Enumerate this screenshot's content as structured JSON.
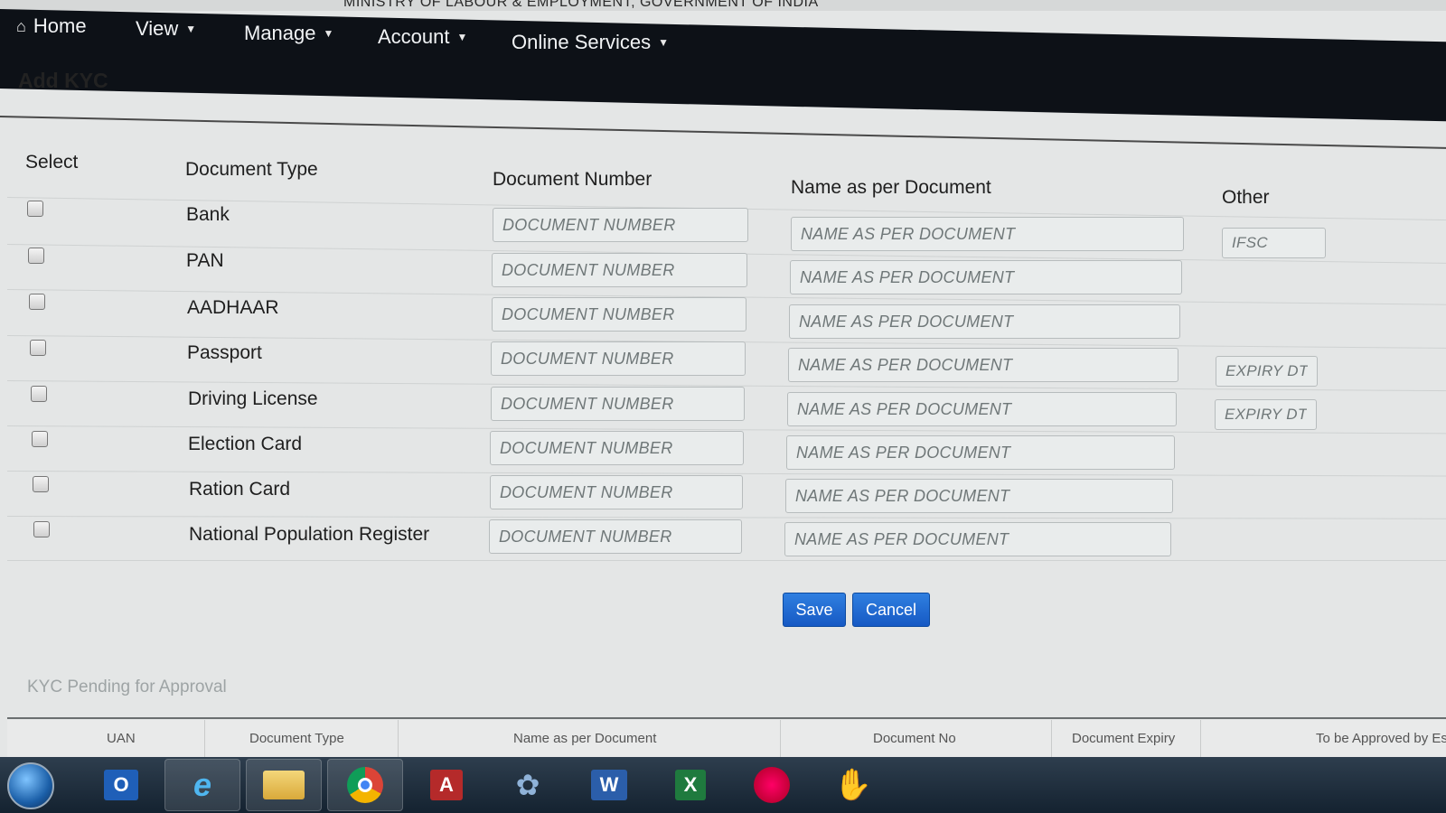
{
  "top_strip": "MINISTRY OF LABOUR & EMPLOYMENT, GOVERNMENT OF INDIA",
  "nav": {
    "home": "Home",
    "view": "View",
    "manage": "Manage",
    "account": "Account",
    "online_services": "Online Services"
  },
  "page_title": "Add KYC",
  "columns": {
    "select": "Select",
    "document_type": "Document Type",
    "document_number": "Document Number",
    "name_as_per_document": "Name as per Document",
    "other": "Other"
  },
  "placeholders": {
    "document_number": "DOCUMENT NUMBER",
    "name": "NAME AS PER DOCUMENT",
    "ifsc": "IFSC",
    "expiry": "EXPIRY DT"
  },
  "documents": [
    {
      "label": "Bank",
      "checked": false
    },
    {
      "label": "PAN",
      "checked": false
    },
    {
      "label": "AADHAAR",
      "checked": false
    },
    {
      "label": "Passport",
      "checked": false
    },
    {
      "label": "Driving License",
      "checked": false
    },
    {
      "label": "Election Card",
      "checked": false
    },
    {
      "label": "Ration Card",
      "checked": false
    },
    {
      "label": "National Population Register",
      "checked": false
    }
  ],
  "buttons": {
    "save": "Save",
    "cancel": "Cancel"
  },
  "pending_title": "KYC Pending for Approval",
  "pending_table": {
    "headers": [
      "UAN",
      "Document Type",
      "Name as per Document",
      "Document No",
      "Document Expiry",
      "To be Approved by Es"
    ]
  },
  "taskbar": {
    "apps": [
      "outlook-icon",
      "internet-explorer-icon",
      "file-explorer-icon",
      "chrome-icon",
      "access-icon",
      "tool-icon",
      "word-icon",
      "excel-icon",
      "media-icon",
      "hand-icon"
    ]
  }
}
